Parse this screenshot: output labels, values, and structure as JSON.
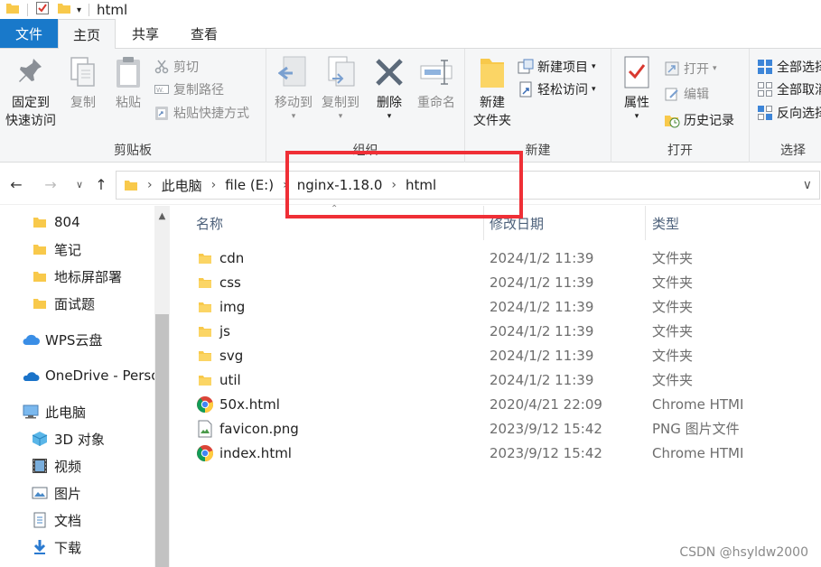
{
  "window": {
    "title": "html"
  },
  "ribbon_tabs": [
    "文件",
    "主页",
    "共享",
    "查看"
  ],
  "ribbon": {
    "clipboard": {
      "label": "剪贴板",
      "pin_line1": "固定到",
      "pin_line2": "快速访问",
      "copy": "复制",
      "paste": "粘贴",
      "cut": "剪切",
      "copy_path": "复制路径",
      "paste_shortcut": "粘贴快捷方式"
    },
    "organize": {
      "label": "组织",
      "move_to": "移动到",
      "copy_to": "复制到",
      "delete": "删除",
      "rename": "重命名"
    },
    "new": {
      "label": "新建",
      "new_folder_line1": "新建",
      "new_folder_line2": "文件夹",
      "new_item": "新建项目",
      "easy_access": "轻松访问"
    },
    "open": {
      "label": "打开",
      "properties": "属性",
      "open": "打开",
      "edit": "编辑",
      "history": "历史记录"
    },
    "select": {
      "label": "选择",
      "select_all": "全部选择",
      "select_none": "全部取消",
      "invert": "反向选择"
    }
  },
  "breadcrumb": [
    "此电脑",
    "file (E:)",
    "nginx-1.18.0",
    "html"
  ],
  "sidebar": {
    "items": [
      {
        "label": "804",
        "icon": "folder-icon"
      },
      {
        "label": "笔记",
        "icon": "folder-icon"
      },
      {
        "label": "地标屏部署",
        "icon": "folder-icon"
      },
      {
        "label": "面试题",
        "icon": "folder-icon"
      },
      {
        "label": "WPS云盘",
        "icon": "cloud-icon"
      },
      {
        "label": "OneDrive - Personal",
        "icon": "onedrive-icon"
      },
      {
        "label": "此电脑",
        "icon": "computer-icon"
      },
      {
        "label": "3D 对象",
        "icon": "3d-objects-icon"
      },
      {
        "label": "视频",
        "icon": "video-icon"
      },
      {
        "label": "图片",
        "icon": "pictures-icon"
      },
      {
        "label": "文档",
        "icon": "documents-icon"
      },
      {
        "label": "下载",
        "icon": "download-icon"
      }
    ]
  },
  "columns": {
    "name": "名称",
    "date": "修改日期",
    "type": "类型"
  },
  "files": [
    {
      "name": "cdn",
      "date": "2024/1/2 11:39",
      "type": "文件夹",
      "icon": "folder-icon"
    },
    {
      "name": "css",
      "date": "2024/1/2 11:39",
      "type": "文件夹",
      "icon": "folder-icon"
    },
    {
      "name": "img",
      "date": "2024/1/2 11:39",
      "type": "文件夹",
      "icon": "folder-icon"
    },
    {
      "name": "js",
      "date": "2024/1/2 11:39",
      "type": "文件夹",
      "icon": "folder-icon"
    },
    {
      "name": "svg",
      "date": "2024/1/2 11:39",
      "type": "文件夹",
      "icon": "folder-icon"
    },
    {
      "name": "util",
      "date": "2024/1/2 11:39",
      "type": "文件夹",
      "icon": "folder-icon"
    },
    {
      "name": "50x.html",
      "date": "2020/4/21 22:09",
      "type": "Chrome HTML",
      "icon": "chrome-icon"
    },
    {
      "name": "favicon.png",
      "date": "2023/9/12 15:42",
      "type": "PNG 图片文件",
      "icon": "png-file-icon"
    },
    {
      "name": "index.html",
      "date": "2023/9/12 15:42",
      "type": "Chrome HTML",
      "icon": "chrome-icon"
    }
  ],
  "watermark": "CSDN @hsyldw2000",
  "colors": {
    "file_tab": "#1979ca",
    "highlight": "#ef2f36",
    "folder": "#f8c94b"
  }
}
